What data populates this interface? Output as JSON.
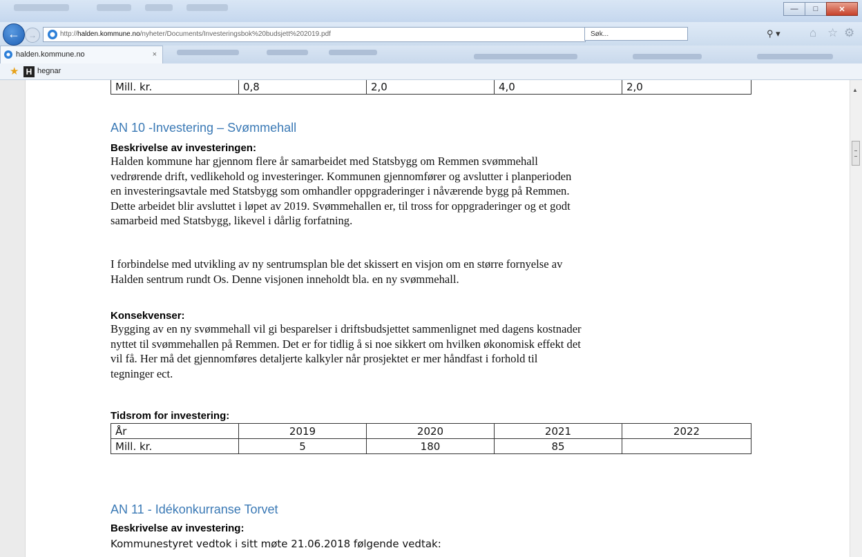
{
  "browser": {
    "address": {
      "protocol": "http://",
      "host": "halden.kommune.no",
      "path": "/nyheter/Documents/Investeringsbok%20budsjett%202019.pdf"
    },
    "search_placeholder": "Søk...",
    "tab_title": "halden.kommune.no",
    "tab_close": "×",
    "favorite_label": "hegnar",
    "favorite_icon_letter": "H"
  },
  "document": {
    "prev_table": {
      "row": [
        "Mill. kr.",
        "0,8",
        "2,0",
        "4,0",
        "2,0"
      ]
    },
    "section_an10": {
      "heading": "AN 10 -Investering – Svømmehall",
      "desc_label": "Beskrivelse av investeringen:",
      "desc_lines": [
        "Halden kommune har gjennom flere år samarbeidet med Statsbygg om Remmen svømmehall",
        "vedrørende drift, vedlikehold og investeringer. Kommunen gjennomfører og avslutter i planperioden",
        "en investeringsavtale med Statsbygg som omhandler oppgraderinger i nåværende bygg på Remmen.",
        "Dette arbeidet blir avsluttet i løpet av 2019. Svømmehallen er, til tross for oppgraderinger og et godt",
        "samarbeid med Statsbygg, likevel i dårlig forfatning."
      ],
      "vision_lines": [
        "I forbindelse med utvikling av ny sentrumsplan ble det skissert en visjon om en større fornyelse av",
        "Halden sentrum rundt Os. Denne visjonen inneholdt bla. en ny svømmehall."
      ],
      "cons_label": "Konsekvenser:",
      "cons_lines": [
        "Bygging av en ny svømmehall vil gi besparelser i driftsbudsjettet sammenlignet med dagens kostnader",
        "nyttet til svømmehallen på Remmen. Det er for tidlig å si noe sikkert om hvilken økonomisk effekt det",
        "vil få. Her må det gjennomføres detaljerte kalkyler når prosjektet er mer håndfast i forhold til",
        "tegninger ect."
      ],
      "timeframe_label": "Tidsrom for investering:",
      "table": {
        "header": [
          "År",
          "2019",
          "2020",
          "2021",
          "2022"
        ],
        "row": [
          "Mill. kr.",
          "5",
          "180",
          "85",
          ""
        ]
      }
    },
    "section_an11": {
      "heading": "AN 11 - Idékonkurranse  Torvet",
      "desc_label": "Beskrivelse av investering:",
      "first_line": "Kommunestyret vedtok i sitt møte 21.06.2018 følgende vedtak:"
    }
  }
}
